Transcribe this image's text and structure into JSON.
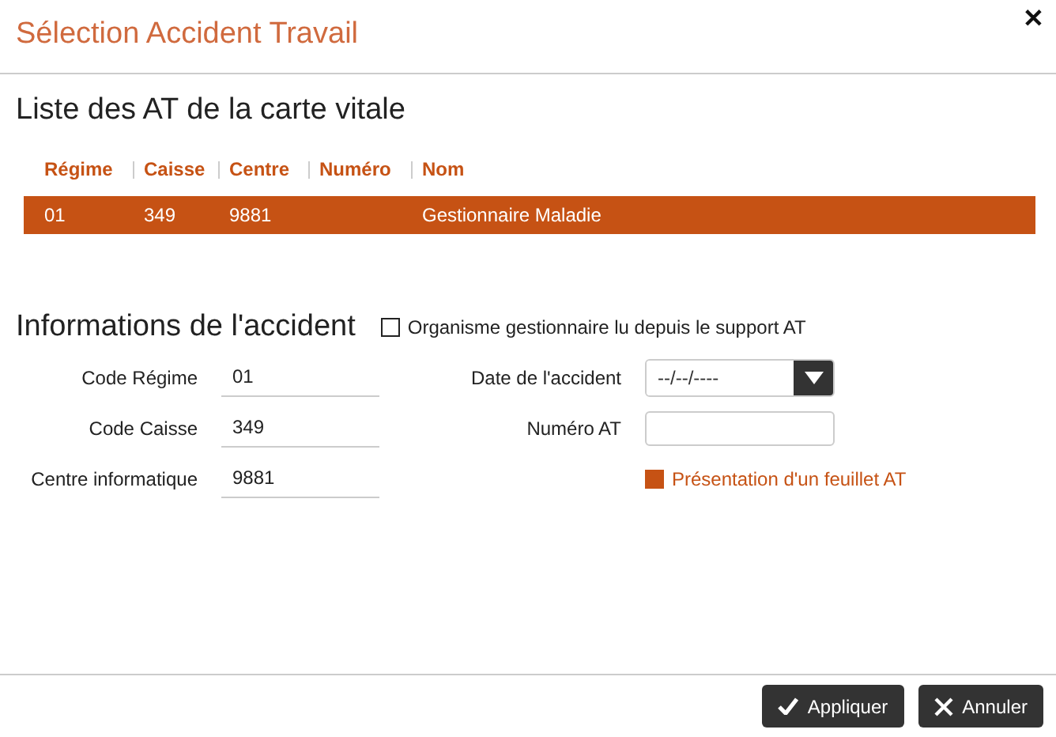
{
  "dialog": {
    "title": "Sélection Accident Travail",
    "close": "✕"
  },
  "list": {
    "heading": "Liste des AT de la carte vitale",
    "columns": [
      "Régime",
      "Caisse",
      "Centre",
      "Numéro",
      "Nom"
    ],
    "rows": [
      {
        "cells": [
          "01",
          "349",
          "9881",
          "",
          "Gestionnaire Maladie"
        ],
        "selected": true
      }
    ]
  },
  "accident": {
    "heading": "Informations de l'accident",
    "source_checkbox": {
      "label": "Organisme gestionnaire lu depuis le support AT",
      "checked": false
    },
    "left_fields": [
      {
        "label": "Code Régime",
        "value": "01"
      },
      {
        "label": "Code Caisse",
        "value": "349"
      },
      {
        "label": "Centre informatique",
        "value": "9881"
      }
    ],
    "date": {
      "label": "Date de l'accident",
      "placeholder": "--/--/----"
    },
    "numero": {
      "label": "Numéro AT"
    },
    "sheet_checkbox": {
      "label": "Présentation d'un feuillet AT",
      "checked": true
    }
  },
  "buttons": [
    {
      "kind": "apply",
      "label": "Appliquer"
    },
    {
      "kind": "cancel",
      "label": "Annuler"
    }
  ]
}
